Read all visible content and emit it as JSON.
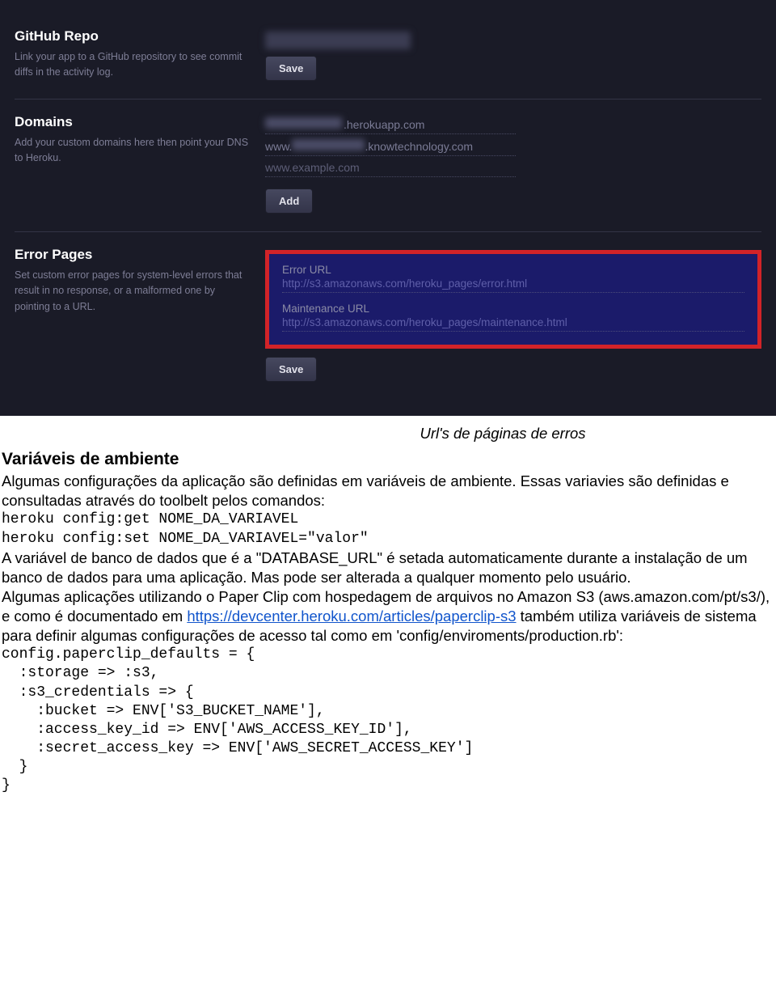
{
  "panel": {
    "github": {
      "title": "GitHub Repo",
      "desc": "Link your app to a GitHub repository to see commit diffs in the activity log.",
      "save": "Save"
    },
    "domains": {
      "title": "Domains",
      "desc": "Add your custom domains here then point your DNS to Heroku.",
      "d1_suffix": ".herokuapp.com",
      "d2_prefix": "www.",
      "d2_suffix": ".knowtechnology.com",
      "placeholder": "www.example.com",
      "add": "Add"
    },
    "error": {
      "title": "Error Pages",
      "desc": "Set custom error pages for system-level errors that result in no response, or a malformed one by pointing to a URL.",
      "error_label": "Error URL",
      "error_url": "http://s3.amazonaws.com/heroku_pages/error.html",
      "maint_label": "Maintenance URL",
      "maint_url": "http://s3.amazonaws.com/heroku_pages/maintenance.html",
      "save": "Save"
    }
  },
  "doc": {
    "caption": "Url's de páginas de erros",
    "h2": "Variáveis de ambiente",
    "p1": "Algumas configurações da aplicação são definidas em variáveis de ambiente. Essas variavies são definidas e consultadas através do toolbelt pelos comandos:",
    "cmd1": "heroku config:get NOME_DA_VARIAVEL",
    "cmd2": "heroku config:set NOME_DA_VARIAVEL=\"valor\"",
    "p2": "A variável de banco de dados que é a \"DATABASE_URL\" é setada automaticamente durante a instalação de um banco de dados para uma aplicação. Mas pode ser alterada a qualquer momento pelo usuário.",
    "p3a": "Algumas aplicações utilizando o Paper Clip com hospedagem de arquivos no Amazon S3 (aws.amazon.com/pt/s3/), e como é documentado em ",
    "link": "https://devcenter.heroku.com/articles/paperclip-s3",
    "p3b": " também utiliza variáveis de sistema para definir algumas configurações de acesso tal como em 'config/enviroments/production.rb':",
    "code": "config.paperclip_defaults = {\n  :storage => :s3,\n  :s3_credentials => {\n    :bucket => ENV['S3_BUCKET_NAME'],\n    :access_key_id => ENV['AWS_ACCESS_KEY_ID'],\n    :secret_access_key => ENV['AWS_SECRET_ACCESS_KEY']\n  }\n}"
  }
}
